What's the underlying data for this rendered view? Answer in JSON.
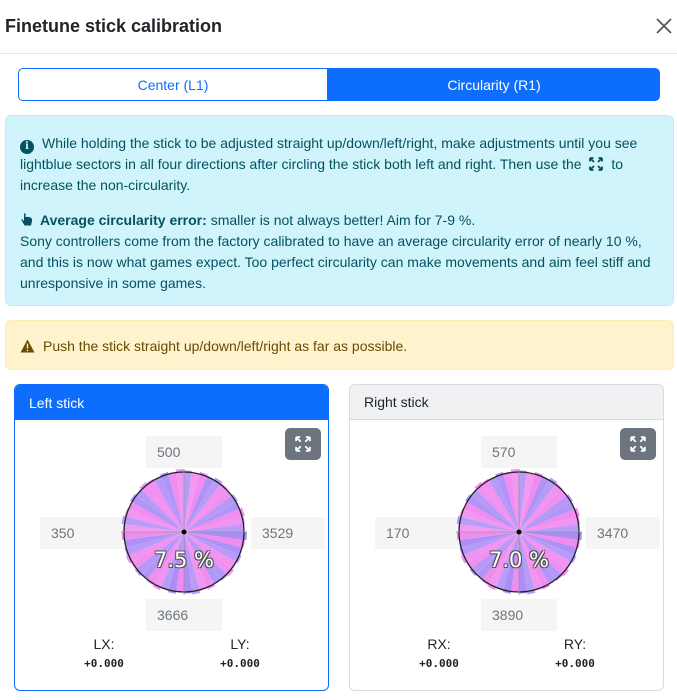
{
  "modal": {
    "title": "Finetune stick calibration"
  },
  "tabs": [
    {
      "label": "Center (L1)",
      "active": false
    },
    {
      "label": "Circularity (R1)",
      "active": true
    }
  ],
  "info": {
    "line1": "While holding the stick to be adjusted straight up/down/left/right, make adjustments until you see lightblue sectors in all four directions after circling the stick both left and right. Then use the",
    "line1_end": "to increase the non-circularity.",
    "avg_label": "Average circularity error:",
    "avg_text": "smaller is not always better! Aim for 7-9 %.",
    "body": "Sony controllers come from the factory calibrated to have an average circularity error of nearly 10 %, and this is now what games expect. Too perfect circularity can make movements and aim feel stiff and unresponsive in some games."
  },
  "warning": {
    "text": "Push the stick straight up/down/left/right as far as possible."
  },
  "left_stick": {
    "title": "Left stick",
    "top": "500",
    "bottom": "3666",
    "left": "350",
    "right": "3529",
    "percent": "7.5 %",
    "x_label": "LX:",
    "y_label": "LY:",
    "x_value": "+0.000",
    "y_value": "+0.000"
  },
  "right_stick": {
    "title": "Right stick",
    "top": "570",
    "bottom": "3890",
    "left": "170",
    "right": "3470",
    "percent": "7.0 %",
    "x_label": "RX:",
    "y_label": "RY:",
    "x_value": "+0.000",
    "y_value": "+0.000"
  },
  "colors": {
    "primary": "#0d6efd",
    "info_bg": "#cff4fc",
    "warning_bg": "#fff3cd",
    "gauge_pink": "#f08cf0",
    "gauge_violet": "#9f7cf5"
  },
  "icons": {
    "close": "close-icon",
    "info": "info-circle-icon",
    "hand": "hand-pointer-icon",
    "expand": "expand-icon",
    "warning": "warning-triangle-icon"
  }
}
